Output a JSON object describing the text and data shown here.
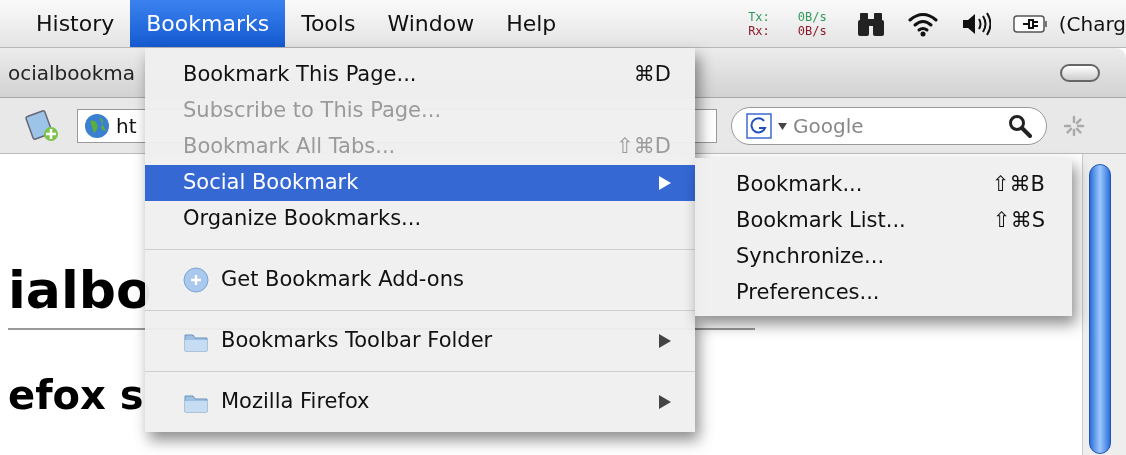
{
  "menu_bar": {
    "items": [
      {
        "label": "History",
        "selected": false
      },
      {
        "label": "Bookmarks",
        "selected": true
      },
      {
        "label": "Tools",
        "selected": false
      },
      {
        "label": "Window",
        "selected": false
      },
      {
        "label": "Help",
        "selected": false
      }
    ],
    "network": {
      "tx_label": "Tx:",
      "tx_value": "0B/s",
      "rx_label": "Rx:",
      "rx_value": "0B/s"
    },
    "battery_text": "(Charg"
  },
  "browser": {
    "title": "ocialbookma",
    "url": "ht",
    "search": {
      "placeholder": "Google"
    },
    "page": {
      "heading": "ialbo",
      "subheading": "efox s"
    }
  },
  "bookmarks_menu": {
    "items": [
      {
        "kind": "command",
        "label": "Bookmark This Page...",
        "shortcut": "⌘D",
        "disabled": false,
        "selected": false
      },
      {
        "kind": "command",
        "label": "Subscribe to This Page...",
        "disabled": true,
        "selected": false
      },
      {
        "kind": "command",
        "label": "Bookmark All Tabs...",
        "shortcut": "⇧⌘D",
        "disabled": true,
        "selected": false
      },
      {
        "kind": "submenu",
        "label": "Social Bookmark",
        "disabled": false,
        "selected": true
      },
      {
        "kind": "command",
        "label": "Organize Bookmarks...",
        "disabled": false,
        "selected": false
      },
      {
        "kind": "separator"
      },
      {
        "kind": "addon",
        "label": "Get Bookmark Add-ons",
        "disabled": false,
        "selected": false
      },
      {
        "kind": "separator"
      },
      {
        "kind": "folder",
        "label": "Bookmarks Toolbar Folder",
        "disabled": false,
        "selected": false
      },
      {
        "kind": "separator"
      },
      {
        "kind": "folder",
        "label": "Mozilla Firefox",
        "disabled": false,
        "selected": false
      }
    ]
  },
  "social_bookmark_submenu": {
    "items": [
      {
        "label": "Bookmark...",
        "shortcut": "⇧⌘B"
      },
      {
        "label": "Bookmark List...",
        "shortcut": "⇧⌘S"
      },
      {
        "label": "Synchronize..."
      },
      {
        "label": "Preferences..."
      }
    ]
  }
}
